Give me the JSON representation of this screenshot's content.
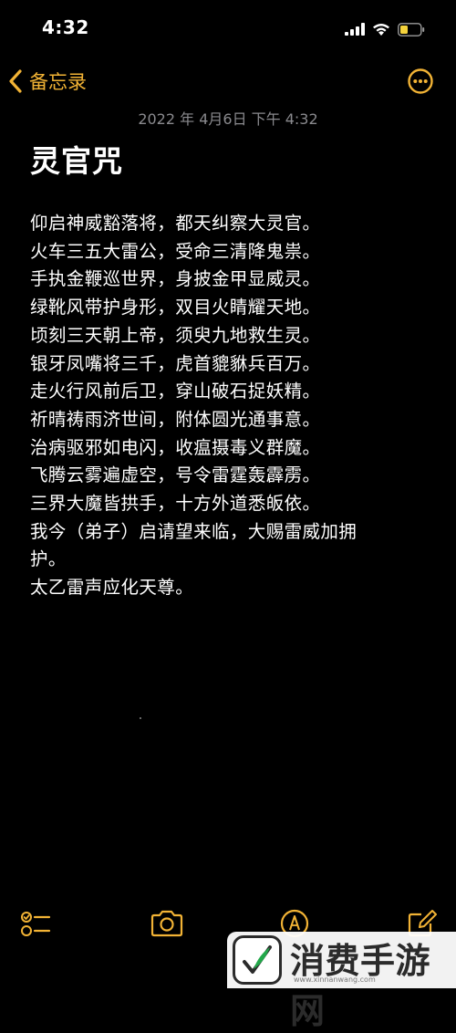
{
  "status_bar": {
    "time": "4:32"
  },
  "nav": {
    "back_label": "备忘录"
  },
  "note": {
    "date": "2022 年 4月6日 下午 4:32",
    "title": "灵官咒",
    "lines": [
      "仰启神威豁落将，都天纠察大灵官。",
      "火车三五大雷公，受命三清降鬼祟。",
      "手执金鞭巡世界，身披金甲显威灵。",
      "绿靴风带护身形，双目火睛耀天地。",
      "顷刻三天朝上帝，须臾九地救生灵。",
      "银牙凤嘴将三千，虎首貔貅兵百万。",
      "走火行风前后卫，穿山破石捉妖精。",
      "祈晴祷雨济世间，附体圆光通事意。",
      "治病驱邪如电闪，收瘟摄毒义群魔。",
      "飞腾云雾遍虚空，号令雷霆轰霹雳。",
      "三界大魔皆拱手，十方外道悉皈依。",
      "我今（弟子）启请望来临，大赐雷威加拥",
      "护。",
      "太乙雷声应化天尊。"
    ]
  },
  "toolbar": {
    "icons": [
      "checklist-icon",
      "camera-icon",
      "markup-icon",
      "compose-icon"
    ]
  },
  "watermark": {
    "text": "消费手游网",
    "url": "www.xinnanwang.com"
  },
  "colors": {
    "accent": "#F2B335",
    "background": "#000000",
    "battery": "#F5D33C"
  }
}
